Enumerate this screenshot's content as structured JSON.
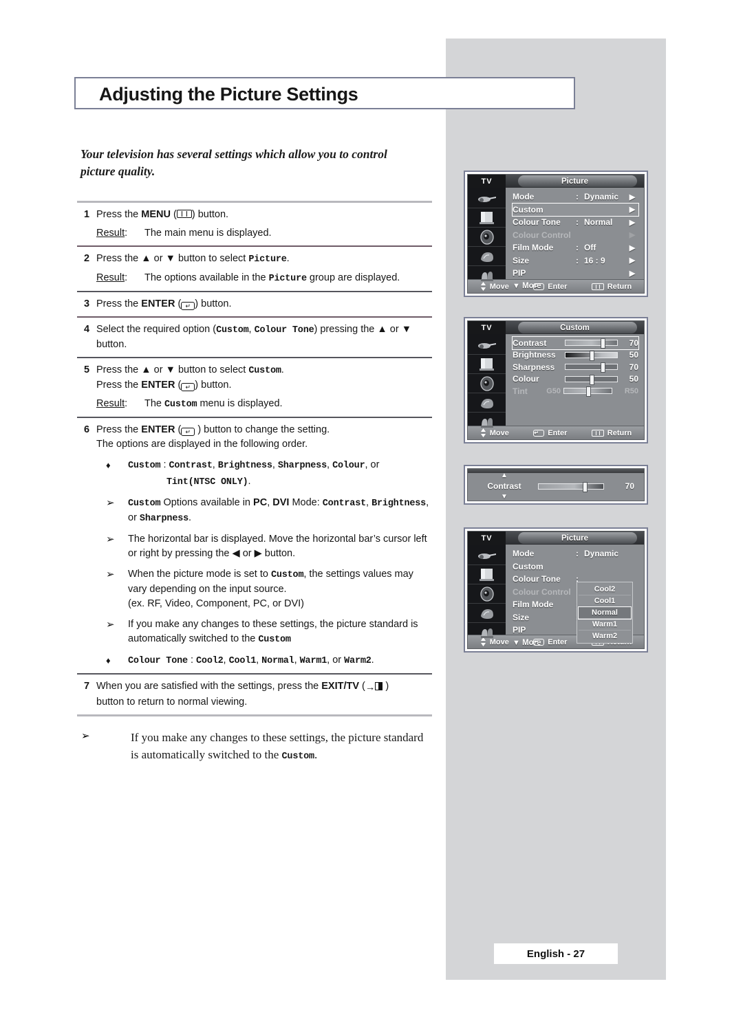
{
  "title": "Adjusting the Picture Settings",
  "intro": "Your television has several settings which allow you to control picture quality.",
  "steps": [
    {
      "num": "1",
      "line1_a": "Press the ",
      "line1_b": "MENU",
      "line1_c": " (",
      "line1_d": ") button.",
      "result_label": "Result",
      "result_colon": ":",
      "result_text": "The main menu is displayed."
    },
    {
      "num": "2",
      "line1_a": "Press the ▲ or ▼ button to select ",
      "line1_mono": "Picture",
      "line1_end": ".",
      "result_label": "Result",
      "result_colon": ":",
      "result_a": "The options available in the ",
      "result_mono": "Picture",
      "result_b": " group are displayed."
    },
    {
      "num": "3",
      "line1_a": "Press the ",
      "line1_b": "ENTER",
      "line1_c": " (",
      "line1_d": ") button."
    },
    {
      "num": "4",
      "line1_a": "Select the required option (",
      "mono1": "Custom",
      "sep": ", ",
      "mono2": "Colour Tone",
      "line1_b": ") pressing the ▲ or ▼ button."
    },
    {
      "num": "5",
      "line1_a": "Press the ▲ or ▼ button to select ",
      "mono1": "Custom",
      "line1_b": ".",
      "line2_a": "Press the ",
      "line2_b": "ENTER",
      "line2_c": " (",
      "line2_d": ") button.",
      "result_label": "Result",
      "result_colon": ":",
      "result_a": "The ",
      "result_mono": "Custom",
      "result_b": " menu is displayed."
    },
    {
      "num": "6",
      "line1_a": "Press the ",
      "line1_b": "ENTER",
      "line1_c": " (",
      "line1_d": " ) button to change the setting.",
      "line2": "The options are displayed in the following order."
    },
    {
      "num": "7",
      "line1_a": "When you are satisfied with the settings, press the ",
      "line1_b": "EXIT/TV",
      "line1_c": " (",
      "line1_d": " )",
      "line2": "button to return to normal viewing."
    }
  ],
  "bullets": {
    "diamond": "♦",
    "arrow": "➢",
    "custom_label": "Custom",
    "custom_colon": ":",
    "custom_opts_1": "Contrast",
    "custom_opts_2": "Brightness",
    "custom_opts_3": "Sharpness",
    "custom_opts_4": "Colour",
    "custom_or": ", or",
    "custom_tint": "Tint(NTSC ONLY)",
    "custom_period": ".",
    "pc_dvi_a": "Custom",
    "pc_dvi_b": " Options available in ",
    "pc_dvi_pc": "PC",
    "pc_dvi_comma": ", ",
    "pc_dvi_dvi": "DVI",
    "pc_dvi_c": " Mode: ",
    "pc_dvi_contrast": "Contrast",
    "pc_dvi_d": ",",
    "pc_dvi_brightness": "Brightness",
    "pc_dvi_e": ", or ",
    "pc_dvi_sharpness": "Sharpness",
    "pc_dvi_f": ".",
    "hbar": "The horizontal bar is displayed. Move the horizontal bar’s cursor left or right by pressing the ◀ or ▶ button.",
    "picmode_a": "When the picture mode is set to ",
    "picmode_mono": "Custom",
    "picmode_b": ", the settings values may vary depending on the input source.",
    "picmode_c": "(ex. RF, Video, Component, PC, or DVI)",
    "changes_a": "If you make any changes to these settings, the picture standard is automatically switched to the ",
    "changes_mono": "Custom",
    "tone_label": "Colour Tone",
    "tone_colon": ":",
    "tone_1": "Cool2",
    "tone_2": "Cool1",
    "tone_3": "Normal",
    "tone_4": "Warm1",
    "tone_5": "Warm2",
    "tone_or": ", or ",
    "tone_period": ".",
    "tone_comma": ", "
  },
  "note": {
    "marker": "➢",
    "text_a": "If you make any changes to these settings, the picture standard is automatically switched to the ",
    "text_mono": "Custom",
    "text_b": "."
  },
  "osd_common": {
    "tv_label": "TV",
    "move": "Move",
    "enter": "Enter",
    "return": "Return",
    "arrow_right": "▶",
    "more_arrow": "▼",
    "more_label": "More"
  },
  "osd_picture_1": {
    "title": "Picture",
    "rows": [
      {
        "label": "Mode",
        "colon": ":",
        "value": "Dynamic",
        "arrow": "▶"
      },
      {
        "label": "Custom",
        "colon": "",
        "value": "",
        "arrow": "▶"
      },
      {
        "label": "Colour Tone",
        "colon": ":",
        "value": "Normal",
        "arrow": "▶"
      },
      {
        "label": "Colour Control",
        "colon": "",
        "value": "",
        "arrow": "▶"
      },
      {
        "label": "Film Mode",
        "colon": ":",
        "value": "Off",
        "arrow": "▶"
      },
      {
        "label": "Size",
        "colon": ":",
        "value": "16 : 9",
        "arrow": "▶"
      },
      {
        "label": "PIP",
        "colon": "",
        "value": "",
        "arrow": "▶"
      }
    ],
    "more": "More"
  },
  "osd_custom": {
    "title": "Custom",
    "rows": [
      {
        "label": "Contrast",
        "pre": "",
        "value": "70",
        "post": "",
        "pct": 70
      },
      {
        "label": "Brightness",
        "pre": "",
        "value": "50",
        "post": "",
        "pct": 50
      },
      {
        "label": "Sharpness",
        "pre": "",
        "value": "70",
        "post": "",
        "pct": 70
      },
      {
        "label": "Colour",
        "pre": "",
        "value": "50",
        "post": "",
        "pct": 50
      },
      {
        "label": "Tint",
        "pre": "G50",
        "value": "",
        "post": "R50",
        "pct": 50
      }
    ]
  },
  "osd_contrast_popup": {
    "label": "Contrast",
    "value": "70",
    "up": "▲",
    "down": "▼",
    "pct": 70
  },
  "osd_picture_2": {
    "title": "Picture",
    "rows": [
      {
        "label": "Mode",
        "colon": ":",
        "value": "Dynamic"
      },
      {
        "label": "Custom",
        "colon": "",
        "value": ""
      },
      {
        "label": "Colour Tone",
        "colon": ":",
        "value": ""
      },
      {
        "label": "Colour Control",
        "colon": "",
        "value": ""
      },
      {
        "label": "Film Mode",
        "colon": ":",
        "value": ""
      },
      {
        "label": "Size",
        "colon": ":",
        "value": ""
      },
      {
        "label": "PIP",
        "colon": "",
        "value": ""
      }
    ],
    "more": "More",
    "dropdown": [
      "Cool2",
      "Cool1",
      "Normal",
      "Warm1",
      "Warm2"
    ],
    "dropdown_selected": "Normal"
  },
  "footer": {
    "page_label": "English - 27"
  },
  "colors": {
    "panel_grey": "#d4d5d7",
    "rule": "#6d5a66",
    "osd_border": "#7a7f95"
  }
}
